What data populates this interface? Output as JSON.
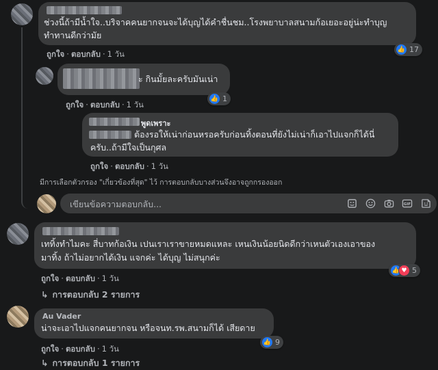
{
  "ui": {
    "like_label": "ถูกใจ",
    "reply_label": "ตอบกลับ",
    "separator": "·",
    "reply_placeholder": "เขียนข้อความตอบกลับ...",
    "filter_note": "มีการเลือกตัวกรอง \"เกี่ยวข้องที่สุด\" ไว้ การตอบกลับบางส่วนจึงอาจถูกกรองออก"
  },
  "comments": [
    {
      "lines": [
        "ช่วงนี้ถ้ามีน้ำใจ..บริจาคคนยากจนจะได้บุญได้คำชื่นชม..โรงพยาบาลสนามก้อเยอะอยู่น่ะทำบุญ",
        "ทำทานดีกว่ามัย"
      ],
      "time": "1 วัน",
      "reactions": {
        "types": [
          "like-icon"
        ],
        "count": "17"
      }
    },
    {
      "lines": [
        "ะ กินมั้ยละครับมันเน่า"
      ],
      "time": "1 วัน",
      "reactions": {
        "types": [
          "like-icon"
        ],
        "count": "1"
      }
    },
    {
      "name": "พูดเพราะ",
      "lines": [
        "ต้องรอให้เน่าก่อนหรอครับก่อนทิ้งตอนที่ยังไม่เน่าก็เอาไปแจกก็ได้นี่",
        "ครับ..ถ้ามีใจเป็นกุศล"
      ],
      "time": "1 วัน"
    },
    {
      "lines": [
        "เททิ้งทำไมคะ สี่บาทก้อเงิน เปนเราเราขายหมดแหละ เหนเงินน้อยนิดดีกว่าเหนตัวเองเอาของ",
        "มาทิ้ง ถ้าไม่อยากได้เงิน แจกค่ะ ได้บุญ ไม่สนุกค่ะ"
      ],
      "time": "1 วัน",
      "reactions": {
        "types": [
          "like-icon",
          "love-icon"
        ],
        "count": "5"
      },
      "view_replies": "การตอบกลับ 2 รายการ"
    },
    {
      "name": "Au Vader",
      "lines": [
        "น่าจะเอาไปแจกคนยากจน หรือจนท.รพ.สนามก็ได้ เสียดาย"
      ],
      "time": "1 วัน",
      "reactions": {
        "types": [
          "like-icon"
        ],
        "count": "9"
      },
      "view_replies": "การตอบกลับ 1 รายการ"
    }
  ],
  "reply_tools": [
    "sticker-icon",
    "emoji-icon",
    "camera-icon",
    "gif-icon",
    "avatar-sticker-icon"
  ],
  "colors": {
    "background": "#18191a",
    "bubble": "#3a3b3c",
    "text_primary": "#e4e6eb",
    "text_secondary": "#b0b3b8",
    "like_blue": "#2078f4",
    "love_red": "#f33e58"
  }
}
